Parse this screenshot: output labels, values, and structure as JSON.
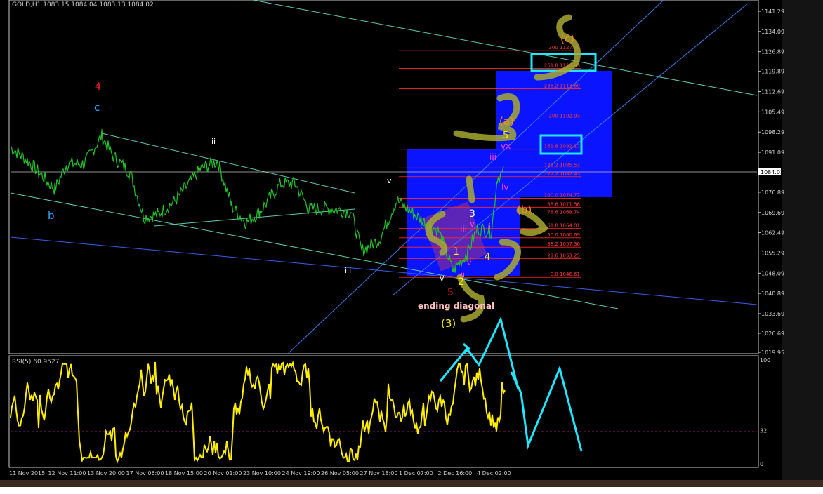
{
  "window": {
    "header": "GOLD,H1  1083.15 1084.04 1083.13 1084.02",
    "rsi_header": "RSI(5) 60.9527"
  },
  "colors": {
    "background": "#000000",
    "price_line": "#22c32a",
    "rsi_line": "#ffee00",
    "channel": "#5fc9b0",
    "fib_line": "#ff2a2a",
    "fib_text": "#ff3b3b",
    "blue_box": "#0a14ff",
    "cyan_arrow": "#22e6ff",
    "scribble": "#a8a832"
  },
  "chart_data": [
    {
      "type": "line",
      "title": "GOLD,H1  1083.15 1084.04 1083.13 1084.02",
      "ylim": [
        1019.95,
        1141.29
      ],
      "y_ticks": [
        "1141.29",
        "1134.09",
        "1126.89",
        "1119.89",
        "1112.69",
        "1105.49",
        "1098.29",
        "1091.09",
        "1084.02",
        "1076.89",
        "1069.69",
        "1062.49",
        "1055.29",
        "1048.09",
        "1040.89",
        "1033.69",
        "1026.69",
        "1019.95"
      ],
      "current_price": "1084.02",
      "x_ticks": [
        "11 Nov 2015",
        "12 Nov 11:00",
        "13 Nov 20:00",
        "17 Nov 06:00",
        "18 Nov 15:00",
        "20 Nov 01:00",
        "23 Nov 10:00",
        "24 Nov 19:00",
        "26 Nov 05:00",
        "27 Nov 18:00",
        "1 Dec 07:00",
        "2 Dec 16:00",
        "4 Dec 02:00"
      ],
      "fib_levels": [
        {
          "ratio": "300",
          "price": "1127.28"
        },
        {
          "ratio": "261.8",
          "price": "1120.93"
        },
        {
          "ratio": "238.2",
          "price": "1113.69"
        },
        {
          "ratio": "200",
          "price": "1102.93"
        },
        {
          "ratio": "161.8",
          "price": "1092.17"
        },
        {
          "ratio": "138.2",
          "price": "1085.53"
        },
        {
          "ratio": "127.2",
          "price": "1082.43"
        },
        {
          "ratio": "100.0",
          "price": "1074.77"
        },
        {
          "ratio": "88.6",
          "price": "1071.56"
        },
        {
          "ratio": "78.6",
          "price": "1068.74"
        },
        {
          "ratio": "61.8",
          "price": "1064.01"
        },
        {
          "ratio": "50.0",
          "price": "1060.69"
        },
        {
          "ratio": "38.2",
          "price": "1057.36"
        },
        {
          "ratio": "23.6",
          "price": "1053.25"
        },
        {
          "ratio": "0.0",
          "price": "1046.61"
        }
      ]
    },
    {
      "type": "line",
      "title": "RSI(5) 60.9527",
      "ylim": [
        0,
        100
      ],
      "y_ticks": [
        "100",
        "32",
        "0"
      ],
      "y_right_label": "32",
      "current_value": 60.9527
    }
  ],
  "annotations": {
    "wave_4": "4",
    "wave_c": "c",
    "wave_b": "b",
    "wave_ii_left": "ii",
    "wave_i_left": "i",
    "wave_iii_left": "iii",
    "wave_iv_mid": "iv",
    "wave_v": "v",
    "wave_5_red": "5",
    "ending_diagonal": "ending diagonal",
    "wave_3_paren": "(3)",
    "wave_a_paren": "(a)",
    "wave_b_paren": "(b)",
    "wave_c_paren": "(c)",
    "wave_5_top": "5",
    "wave_vx": "vx",
    "wave_iii_r": "iii",
    "wave_iv_r": "iv",
    "wave_3_w": "3",
    "wave_1_y": "1",
    "wave_2_y": "2",
    "wave_4_y": "4",
    "wave_iii_m": "iii",
    "wave_v_m": "v",
    "wave_iv_m": "iv",
    "wave_ii_m": "ii",
    "wave_i_m": "i",
    "wave_ii_pink": "ii"
  }
}
